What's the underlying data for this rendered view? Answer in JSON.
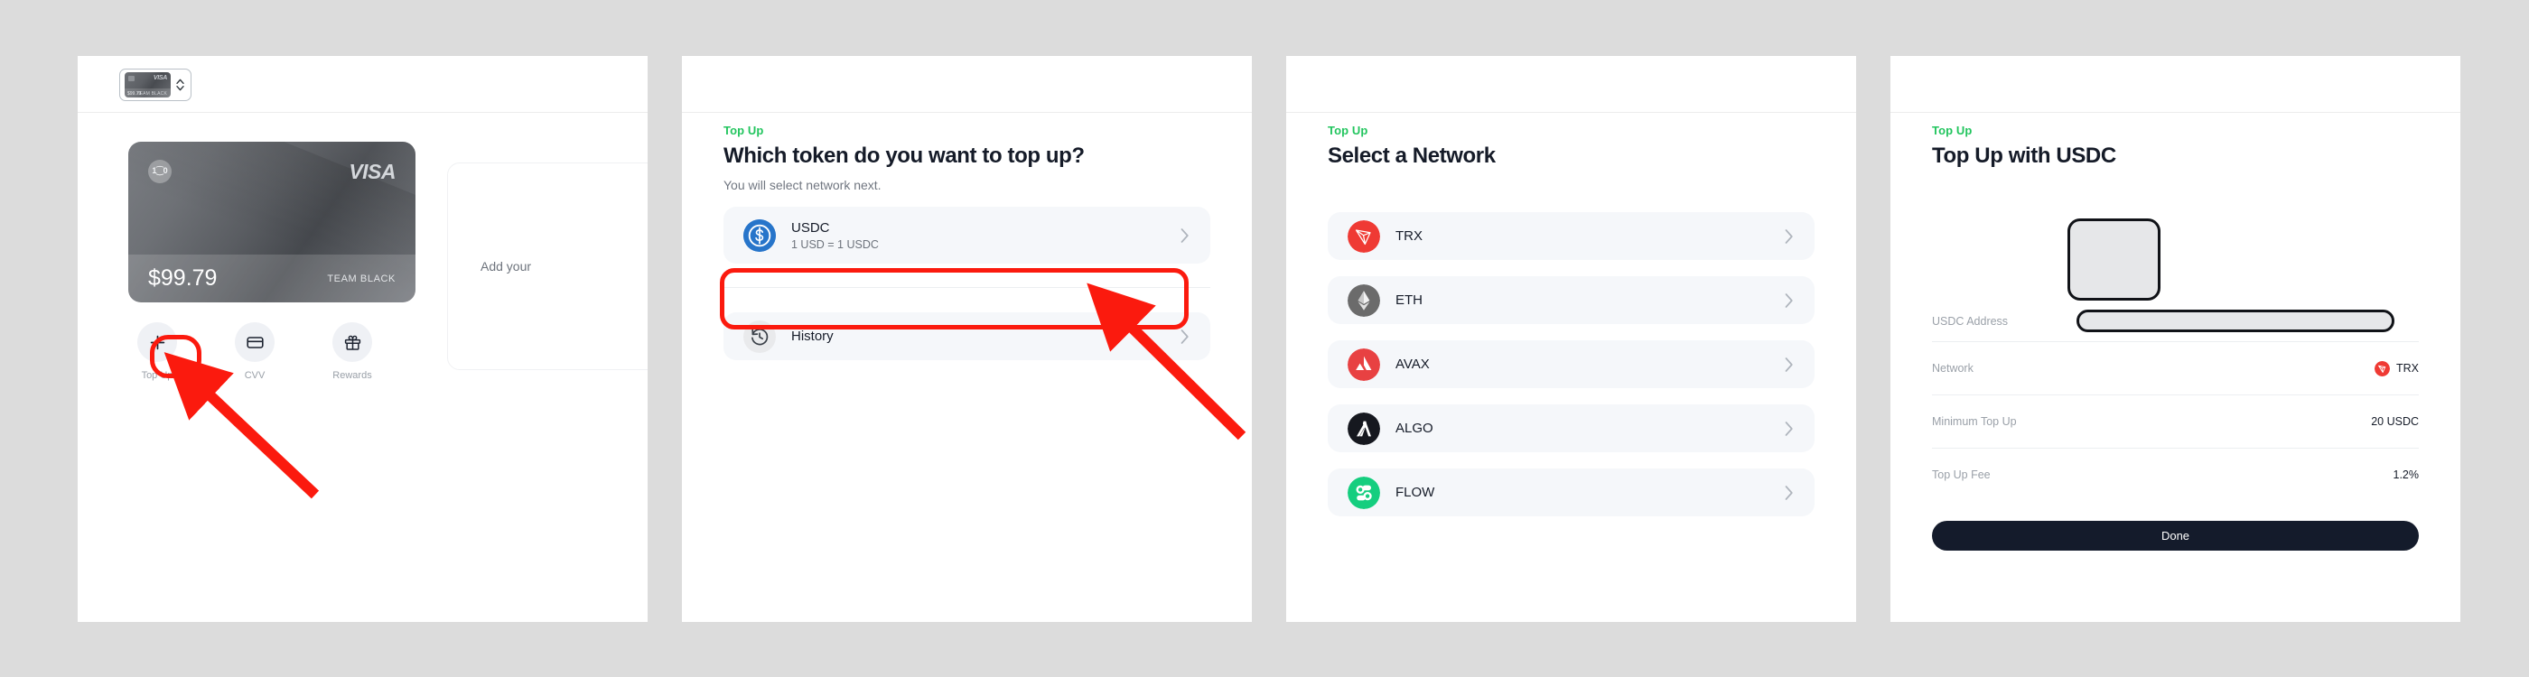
{
  "panels": [
    {
      "id": "wallet",
      "card_selector": {
        "mini_card": {
          "visa_label": "VISA",
          "team_label": "TEAM BLACK",
          "amount": "$99.79"
        },
        "stepper_icon": "chevron-up-down-icon"
      },
      "card": {
        "brand": "VISA",
        "balance": "$99.79",
        "tier": "TEAM BLACK",
        "logo_glyph": "1⁐0"
      },
      "actions": [
        {
          "label": "Top Up",
          "icon": "plus-icon"
        },
        {
          "label": "CVV",
          "icon": "credit-card-icon"
        },
        {
          "label": "Rewards",
          "icon": "gift-icon"
        }
      ],
      "side_panel_text": "Add your "
    },
    {
      "id": "select-token",
      "eyebrow": "Top Up",
      "title": "Which token do you want to top up?",
      "subtitle": "You will select network next.",
      "tokens": [
        {
          "name": "USDC",
          "rate": "1 USD = 1 USDC",
          "icon": "usdc-icon",
          "color": "#2775ca"
        }
      ],
      "history": {
        "label": "History",
        "icon": "history-clock-icon"
      }
    },
    {
      "id": "select-network",
      "eyebrow": "Top Up",
      "title": "Select a Network",
      "networks": [
        {
          "name": "TRX",
          "icon": "tron-icon",
          "color": "#ef3a34"
        },
        {
          "name": "ETH",
          "icon": "ethereum-icon",
          "color": "#6b6b6b"
        },
        {
          "name": "AVAX",
          "icon": "avalanche-icon",
          "color": "#e84142"
        },
        {
          "name": "ALGO",
          "icon": "algorand-icon",
          "color": "#16181f"
        },
        {
          "name": "FLOW",
          "icon": "flow-icon",
          "color": "#15ce7f"
        }
      ]
    },
    {
      "id": "topup-usdc",
      "eyebrow": "Top Up",
      "title": "Top Up with USDC",
      "qr_code": "qr-code-placeholder",
      "address_label": "USDC Address",
      "address_value": "",
      "details": [
        {
          "key": "Network",
          "value": "TRX",
          "icon": "tron-icon",
          "color": "#ef3a34"
        },
        {
          "key": "Minimum Top Up",
          "value": "20 USDC",
          "icon": "",
          "color": ""
        },
        {
          "key": "Top Up Fee",
          "value": "1.2%",
          "icon": "",
          "color": ""
        }
      ],
      "primary_button": "Done"
    }
  ],
  "annotations": {
    "color": "#fb1a0e",
    "highlights": [
      "top-up-action-button",
      "usdc-token-row"
    ],
    "arrows": [
      "arrow-to-top-up-button",
      "arrow-to-usdc-row"
    ]
  }
}
